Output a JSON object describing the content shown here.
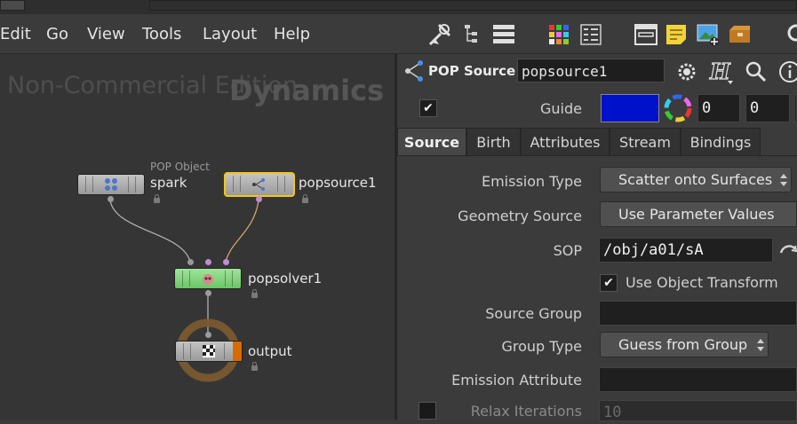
{
  "menu": {
    "items": [
      "Edit",
      "Go",
      "View",
      "Tools",
      "Layout",
      "Help"
    ]
  },
  "toolbar": {
    "icons": [
      "wrench-icon",
      "tree-view-icon",
      "list-view-icon",
      "color-grid-icon",
      "details-view-icon",
      "layout-icon",
      "sticky-note-icon",
      "image-add-icon",
      "network-box-icon",
      "search-icon"
    ]
  },
  "network": {
    "watermark_edition": "Non-Commercial Edition",
    "watermark_context": "Dynamics",
    "nodes": {
      "spark": {
        "type_label": "POP Object",
        "name": "spark"
      },
      "popsource": {
        "name": "popsource1"
      },
      "popsolver": {
        "name": "popsolver1"
      },
      "output": {
        "name": "output"
      }
    }
  },
  "params": {
    "node_type": "POP Source",
    "node_name": "popsource1",
    "guide": {
      "label": "Guide",
      "checked": "✔",
      "color": "#0011cc",
      "values": [
        "0",
        "0"
      ]
    },
    "tabs": [
      "Source",
      "Birth",
      "Attributes",
      "Stream",
      "Bindings"
    ],
    "active_tab": "Source",
    "fields": {
      "emission_type": {
        "label": "Emission Type",
        "value": "Scatter onto Surfaces"
      },
      "geometry_source": {
        "label": "Geometry Source",
        "value": "Use Parameter Values"
      },
      "sop": {
        "label": "SOP",
        "value": "/obj/a01/sA"
      },
      "use_object_transform": {
        "label": "Use Object Transform",
        "checked": "✔"
      },
      "source_group": {
        "label": "Source Group",
        "value": ""
      },
      "group_type": {
        "label": "Group Type",
        "value": "Guess from Group"
      },
      "emission_attribute": {
        "label": "Emission Attribute",
        "value": ""
      },
      "relax_iterations": {
        "label": "Relax Iterations",
        "value": "10"
      }
    }
  },
  "colors": {
    "accent_selected": "#f5c518",
    "output_flag": "#d86b00",
    "output_ring": "#7a5a30",
    "guide_color": "#0011cc"
  }
}
